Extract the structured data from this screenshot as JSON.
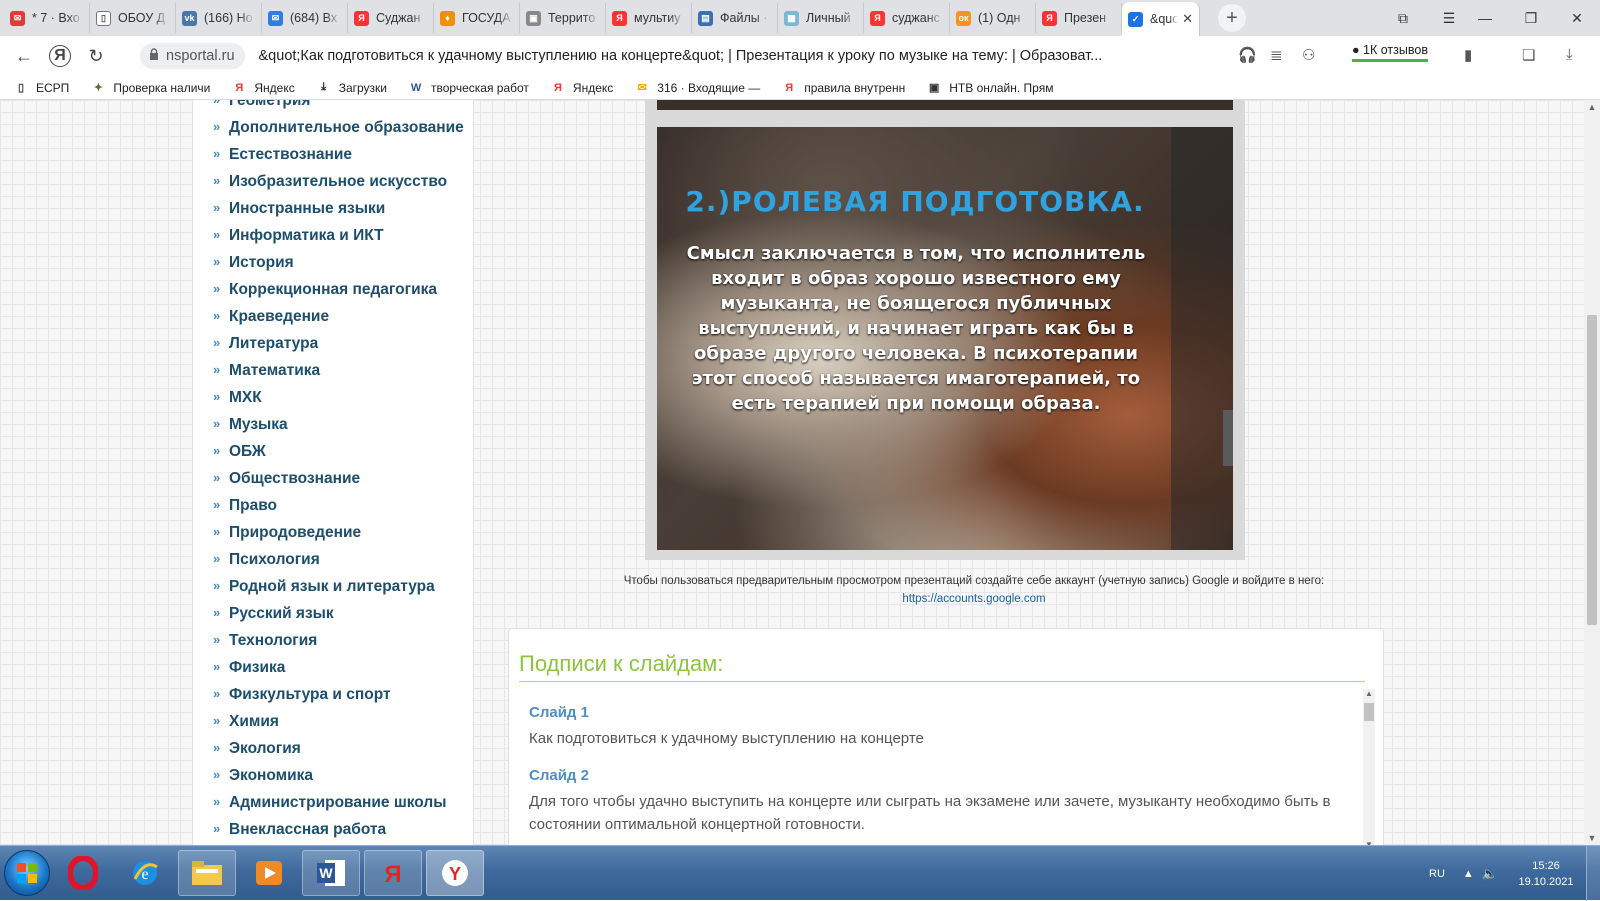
{
  "browser": {
    "tabs": [
      {
        "title": "* 7 · Вхо",
        "color": "#e53935",
        "glyph": "✉"
      },
      {
        "title": "ОБОУ Д",
        "color": "#ffffff",
        "glyph": "▯"
      },
      {
        "title": "(166) Но",
        "color": "#4a76a8",
        "glyph": "vk"
      },
      {
        "title": "(684) Вх",
        "color": "#2f7de1",
        "glyph": "✉"
      },
      {
        "title": "Суджан",
        "color": "#f33",
        "glyph": "Я"
      },
      {
        "title": "ГОСУДА",
        "color": "#f29100",
        "glyph": "♦"
      },
      {
        "title": "Террито",
        "color": "#888888",
        "glyph": "▣"
      },
      {
        "title": "мультиу",
        "color": "#f33",
        "glyph": "Я"
      },
      {
        "title": "Файлы ·",
        "color": "#3a6fb0",
        "glyph": "▤"
      },
      {
        "title": "Личный",
        "color": "#7bb8d4",
        "glyph": "▦"
      },
      {
        "title": "суджанс",
        "color": "#f33",
        "glyph": "Я"
      },
      {
        "title": "(1) Одн",
        "color": "#f7931e",
        "glyph": "ок"
      },
      {
        "title": "Презен",
        "color": "#f33",
        "glyph": "Я"
      },
      {
        "title": "&quo",
        "color": "#1a73e8",
        "glyph": "✓",
        "active": true
      }
    ],
    "new_tab": "+",
    "domain": "nsportal.ru",
    "page_title": "&quot;Как подготовиться к удачному выступлению на концерте&quot; | Презентация к уроку по музыке на тему: | Образоват...",
    "reviews": "1К отзывов",
    "bookmarks": [
      {
        "label": "ЕСРП",
        "icon": "▯",
        "color": "#444444"
      },
      {
        "label": "Проверка наличи",
        "icon": "✦",
        "color": "#556b2f"
      },
      {
        "label": "Яндекс",
        "icon": "Я",
        "color": "#f33"
      },
      {
        "label": "Загрузки",
        "icon": "⤓",
        "color": "#222222"
      },
      {
        "label": "творческая работ",
        "icon": "W",
        "color": "#2b579a"
      },
      {
        "label": "Яндекс",
        "icon": "Я",
        "color": "#f33"
      },
      {
        "label": "316 · Входящие —",
        "icon": "✉",
        "color": "#f2a900"
      },
      {
        "label": "правила внутренн",
        "icon": "Я",
        "color": "#f33"
      },
      {
        "label": "НТВ онлайн. Прям",
        "icon": "▣",
        "color": "#333333"
      }
    ]
  },
  "sidebar": {
    "items": [
      "Геометрия",
      "Дополнительное образование",
      "Естествознание",
      "Изобразительное искусство",
      "Иностранные языки",
      "Информатика и ИКТ",
      "История",
      "Коррекционная педагогика",
      "Краеведение",
      "Литература",
      "Математика",
      "МХК",
      "Музыка",
      "ОБЖ",
      "Обществознание",
      "Право",
      "Природоведение",
      "Психология",
      "Родной язык и литература",
      "Русский язык",
      "Технология",
      "Физика",
      "Физкультура и спорт",
      "Химия",
      "Экология",
      "Экономика",
      "Администрирование школы",
      "Внеклассная работа"
    ]
  },
  "slide": {
    "title": "2.)РОЛЕВАЯ ПОДГОТОВКА.",
    "text": "Смысл заключается в том, что исполнитель входит в образ хорошо известного ему музыканта, не боящегося публичных выступлений, и начинает играть как бы в образе другого человека. В психотерапии этот способ называется имаготерапией, то есть терапией при  помощи образа."
  },
  "note": {
    "text": "Чтобы пользоваться предварительным просмотром презентаций создайте себе аккаунт (учетную запись) Google и войдите в него:",
    "link": "https://accounts.google.com"
  },
  "captions": {
    "heading": "Подписи к слайдам:",
    "slides": [
      {
        "title": "Слайд 1",
        "text": "Как подготовиться к удачному выступлению на концерте"
      },
      {
        "title": "Слайд 2",
        "text": "Для того чтобы удачно выступить на концерте или сыграть на экзамене или зачете, музыканту необходимо быть в состоянии оптимальной концертной готовности."
      }
    ]
  },
  "taskbar": {
    "lang": "RU",
    "time": "15:26",
    "date": "19.10.2021"
  }
}
